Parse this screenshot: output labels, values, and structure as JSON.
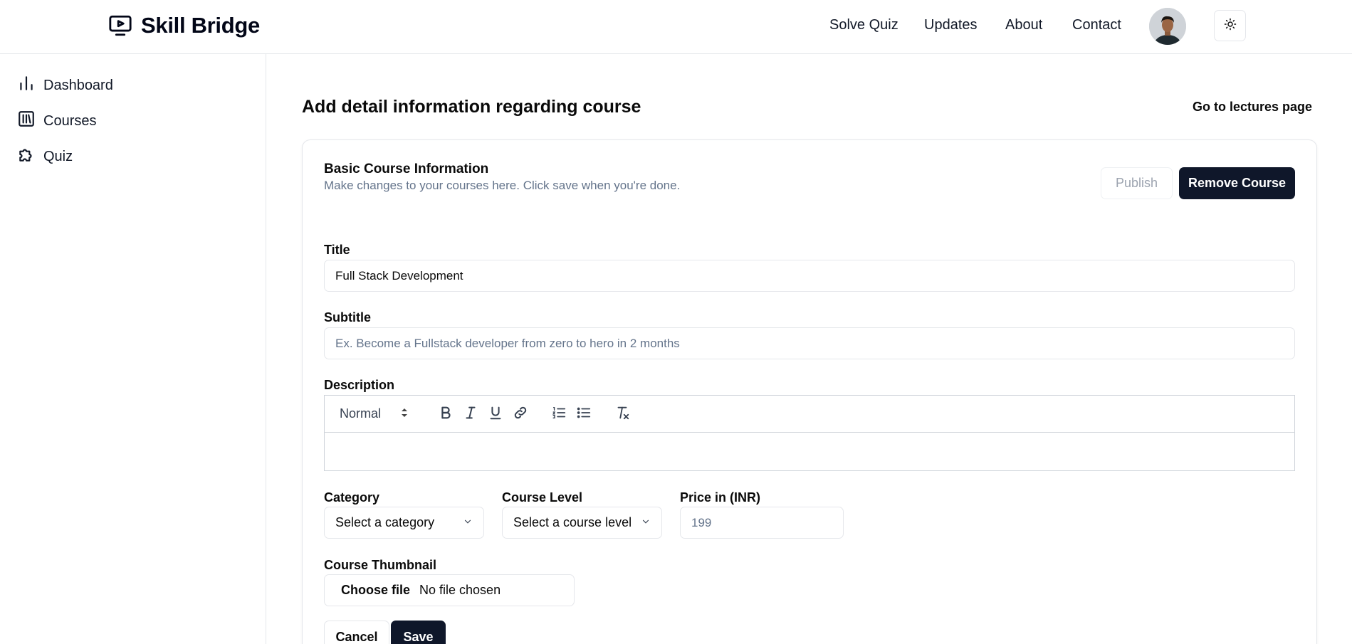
{
  "header": {
    "brand": "Skill Bridge",
    "brand_icon": "video-player-icon",
    "nav": [
      "Solve Quiz",
      "Updates",
      "About",
      "Contact"
    ],
    "theme_icon": "sun-icon"
  },
  "sidebar": {
    "items": [
      {
        "label": "Dashboard",
        "icon": "bar-chart-icon"
      },
      {
        "label": "Courses",
        "icon": "library-icon"
      },
      {
        "label": "Quiz",
        "icon": "puzzle-icon"
      }
    ]
  },
  "main": {
    "title": "Add detail information regarding course",
    "goto_label": "Go to lectures page"
  },
  "card": {
    "title": "Basic Course Information",
    "description": "Make changes to your courses here. Click save when you're done.",
    "publish_label": "Publish",
    "remove_label": "Remove Course"
  },
  "form": {
    "title_label": "Title",
    "title_value": "Full Stack Development",
    "subtitle_label": "Subtitle",
    "subtitle_placeholder": "Ex. Become a Fullstack developer from zero to hero in 2 months",
    "description_label": "Description",
    "editor_format": "Normal",
    "category_label": "Category",
    "category_value": "Select a category",
    "level_label": "Course Level",
    "level_value": "Select a course level",
    "price_label": "Price in (INR)",
    "price_placeholder": "199",
    "thumbnail_label": "Course Thumbnail",
    "file_button": "Choose file",
    "file_status": "No file chosen",
    "cancel_label": "Cancel",
    "save_label": "Save"
  },
  "colors": {
    "primary": "#0f172a",
    "muted_text": "#64748b",
    "border": "#e5e7eb"
  }
}
